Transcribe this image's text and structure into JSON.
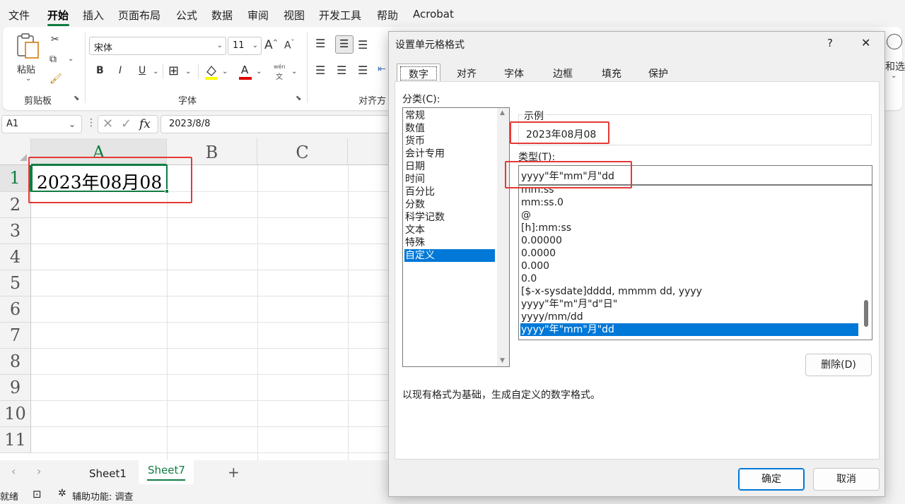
{
  "menu": {
    "items": [
      "文件",
      "开始",
      "插入",
      "页面布局",
      "公式",
      "数据",
      "审阅",
      "视图",
      "开发工具",
      "帮助",
      "Acrobat"
    ],
    "active_index": 1
  },
  "ribbon": {
    "clipboard": {
      "paste_label": "粘贴",
      "group_label": "剪贴板"
    },
    "font": {
      "font_name": "宋体",
      "font_size": "11",
      "bold": "B",
      "italic": "I",
      "underline": "U",
      "phonetic_top": "wén",
      "phonetic_bottom": "文",
      "grow": "A",
      "shrink": "A",
      "font_color_letter": "A",
      "group_label": "字体"
    },
    "alignment": {
      "group_label": "对齐方"
    },
    "right_partial": "和选"
  },
  "formula_bar": {
    "name_box": "A1",
    "fx": "fx",
    "content": "2023/8/8"
  },
  "grid": {
    "columns": [
      "A",
      "B",
      "C"
    ],
    "rows": [
      "1",
      "2",
      "3",
      "4",
      "5",
      "6",
      "7",
      "8",
      "9",
      "10",
      "11"
    ],
    "cell_a1": "2023年08月08"
  },
  "sheets": {
    "tabs": [
      "Sheet1",
      "Sheet7"
    ],
    "active": "Sheet7",
    "add": "+"
  },
  "status": {
    "ready": "就绪",
    "accessibility": "辅助功能: 调查"
  },
  "dialog": {
    "title": "设置单元格格式",
    "help": "?",
    "close": "✕",
    "tabs": [
      "数字",
      "对齐",
      "字体",
      "边框",
      "填充",
      "保护"
    ],
    "selected_tab": "数字",
    "category_label": "分类(C):",
    "categories": [
      "常规",
      "数值",
      "货币",
      "会计专用",
      "日期",
      "时间",
      "百分比",
      "分数",
      "科学记数",
      "文本",
      "特殊",
      "自定义"
    ],
    "selected_category": "自定义",
    "sample_label": "示例",
    "sample_value": "2023年08月08",
    "type_label": "类型(T):",
    "type_value": "yyyy\"年\"mm\"月\"dd",
    "type_list": [
      "mm:ss",
      "mm:ss.0",
      "@",
      "[h]:mm:ss",
      "0.00000",
      "0.0000",
      "0.000",
      "0.0",
      "[$-x-sysdate]dddd, mmmm dd, yyyy",
      "yyyy\"年\"m\"月\"d\"日\"",
      "yyyy/mm/dd",
      "yyyy\"年\"mm\"月\"dd"
    ],
    "selected_type": "yyyy\"年\"mm\"月\"dd",
    "delete_button": "删除(D)",
    "description": "以现有格式为基础，生成自定义的数字格式。",
    "ok_button": "确定",
    "cancel_button": "取消"
  },
  "colors": {
    "excel_green": "#107c41",
    "selection_blue": "#0078d7",
    "highlight_red": "#e53935"
  }
}
